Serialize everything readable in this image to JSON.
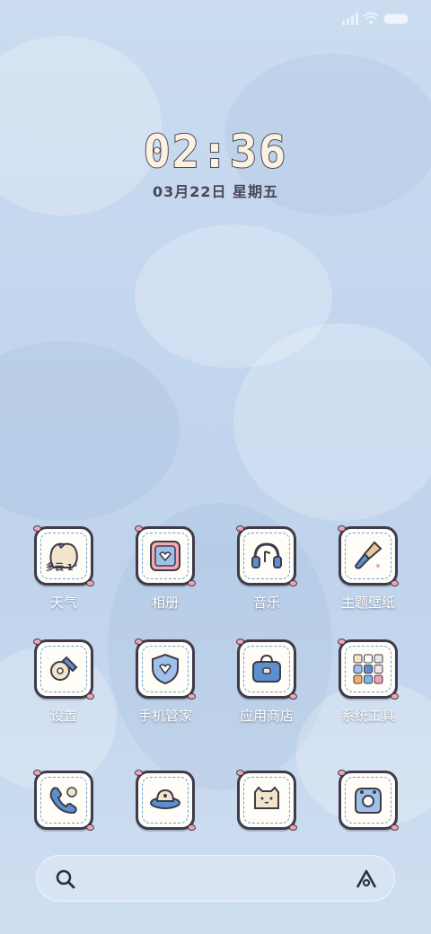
{
  "status_bar": {
    "signal_icon": "signal-icon",
    "wifi_icon": "wifi-icon",
    "battery_icon": "battery-icon"
  },
  "clock": {
    "time": "02:36",
    "date": "03月22日 星期五"
  },
  "apps": [
    {
      "label": "天气",
      "icon": "weather-icon",
      "badge_text": "多云 1°"
    },
    {
      "label": "相册",
      "icon": "gallery-icon"
    },
    {
      "label": "音乐",
      "icon": "music-icon"
    },
    {
      "label": "主题壁纸",
      "icon": "theme-icon"
    },
    {
      "label": "设置",
      "icon": "settings-icon"
    },
    {
      "label": "手机管家",
      "icon": "security-icon"
    },
    {
      "label": "应用商店",
      "icon": "app-store-icon"
    },
    {
      "label": "系统工具",
      "icon": "tools-folder-icon"
    },
    {
      "label": "",
      "icon": "phone-icon"
    },
    {
      "label": "",
      "icon": "browser-icon"
    },
    {
      "label": "",
      "icon": "messages-icon"
    },
    {
      "label": "",
      "icon": "camera-icon"
    }
  ],
  "dock": {
    "search_icon": "search-icon",
    "assistant_icon": "assistant-icon"
  },
  "colors": {
    "outline": "#3f3b48",
    "accent_blue": "#6fa0d6",
    "heart_pink": "#f2a3b3",
    "tile_bg": "#fffdf8"
  }
}
